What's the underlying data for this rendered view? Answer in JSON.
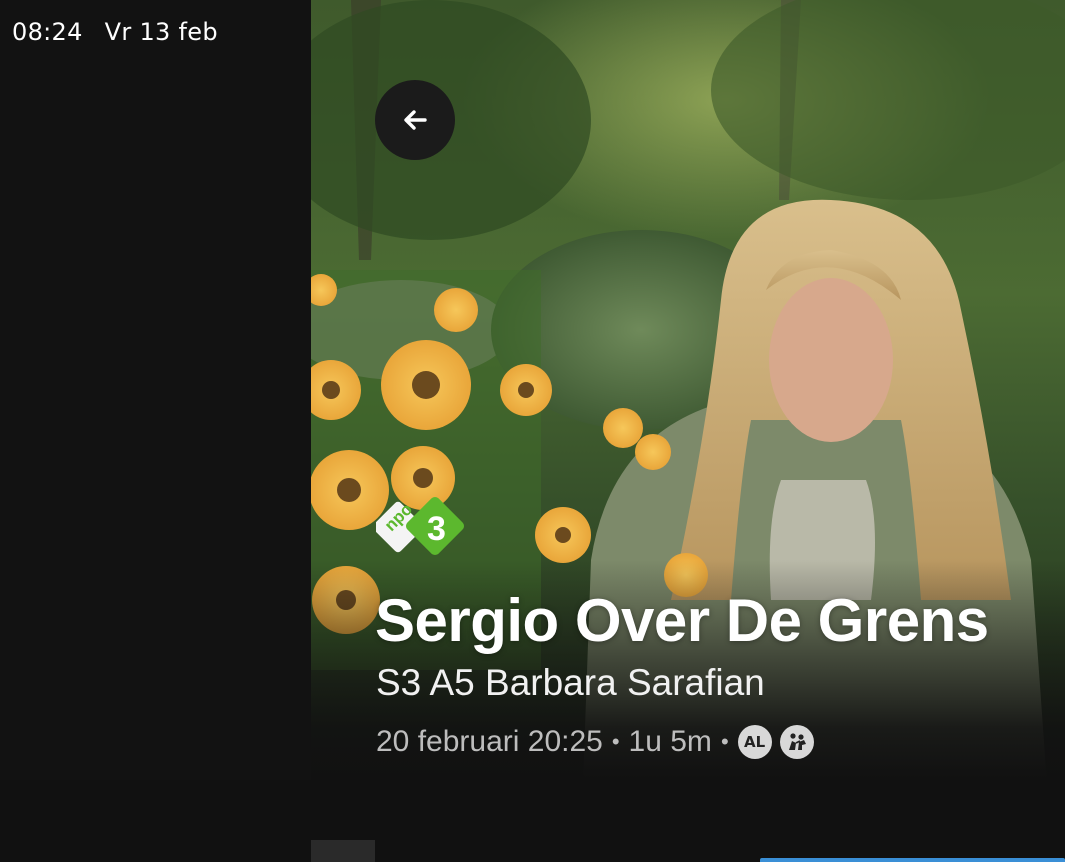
{
  "status_bar": {
    "time": "08:24",
    "date": "Vr 13 feb"
  },
  "hero": {
    "image_description_icon": "hero-image"
  },
  "back_button": {
    "icon": "arrow-left-icon"
  },
  "channel": {
    "logo_text_npo": "npo",
    "logo_text_number": "3",
    "colors": {
      "green": "#5cb82e",
      "white": "#f4f4f4"
    }
  },
  "program": {
    "title": "Sergio Over De Grens",
    "episode": "S3 A5 Barbara Sarafian",
    "air_date": "20 februari 20:25",
    "duration": "1u 5m",
    "separator": "•",
    "age_rating": "AL",
    "content_icon": "violence-icon"
  },
  "colors": {
    "background": "#111111",
    "accent": "#3a8fd6"
  }
}
